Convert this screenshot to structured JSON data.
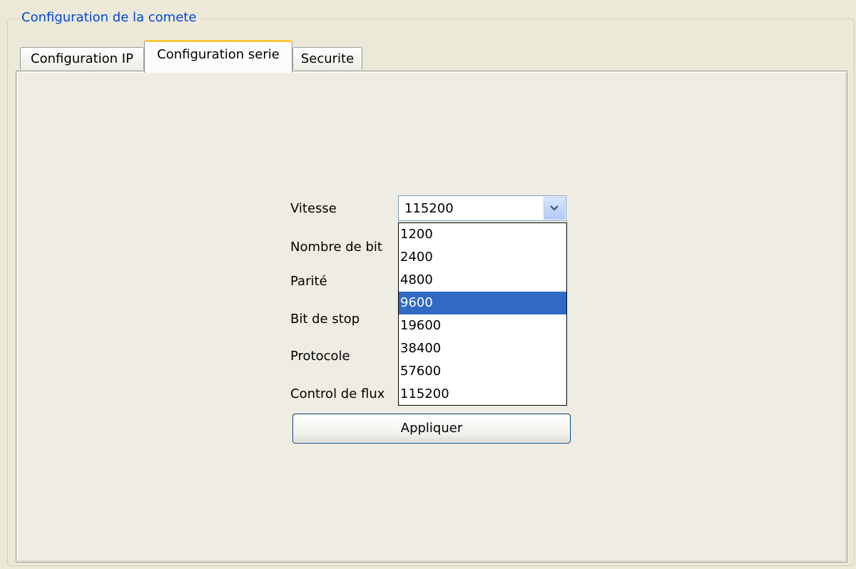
{
  "group": {
    "title": "Configuration de la comete"
  },
  "tabs": [
    {
      "label": "Configuration IP"
    },
    {
      "label": "Configuration serie"
    },
    {
      "label": "Securite"
    }
  ],
  "form": {
    "labels": {
      "speed": "Vitesse",
      "bits": "Nombre de bit",
      "parity": "Parité",
      "stop_bit": "Bit de stop",
      "protocol": "Protocole",
      "flow_control": "Control de flux"
    },
    "speed_value": "115200",
    "speed_options": [
      "1200",
      "2400",
      "4800",
      "9600",
      "19600",
      "38400",
      "57600",
      "115200"
    ],
    "highlighted_option": "9600",
    "apply_label": "Appliquer"
  }
}
